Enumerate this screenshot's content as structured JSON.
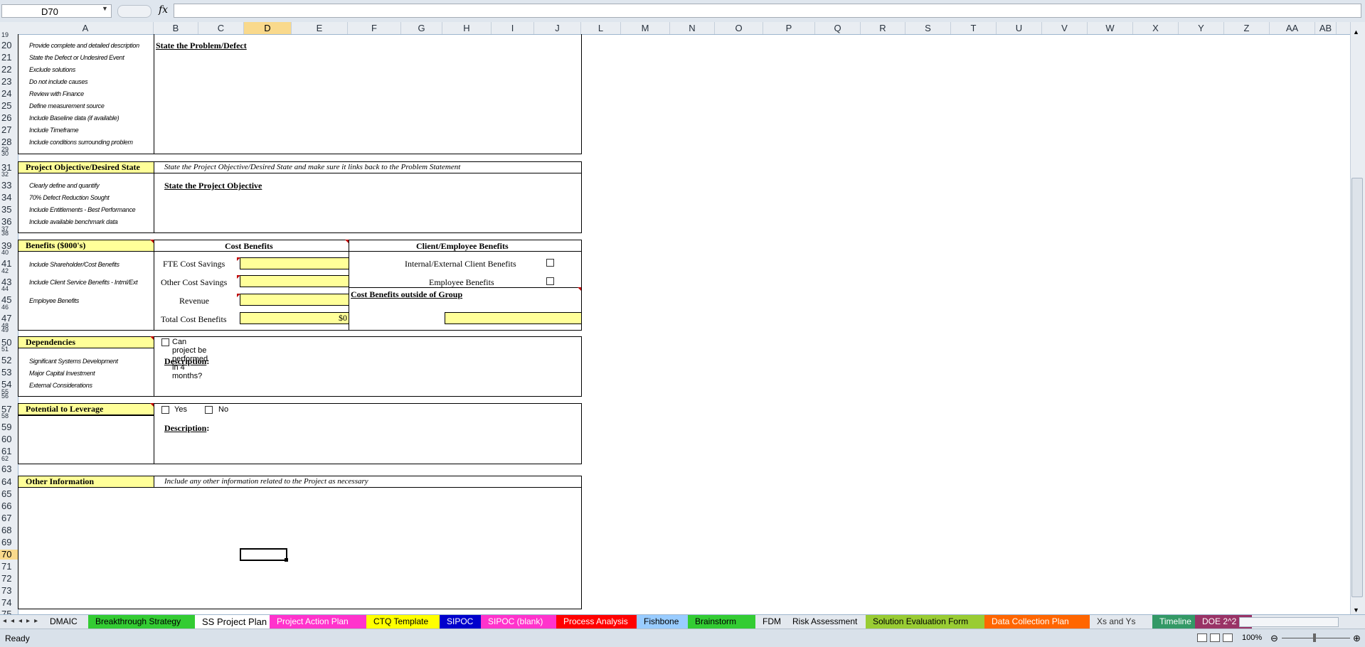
{
  "formula_bar": {
    "name_box": "D70",
    "fx": "fx",
    "formula": ""
  },
  "columns": [
    "A",
    "B",
    "C",
    "D",
    "E",
    "F",
    "G",
    "H",
    "I",
    "J",
    "L",
    "M",
    "N",
    "O",
    "P",
    "Q",
    "R",
    "S",
    "T",
    "U",
    "V",
    "W",
    "X",
    "Y",
    "Z",
    "AA",
    "AB"
  ],
  "selected_column": "D",
  "rows": [
    "19",
    "20",
    "21",
    "22",
    "23",
    "24",
    "25",
    "26",
    "27",
    "28",
    "29",
    "30",
    "31",
    "32",
    "33",
    "34",
    "35",
    "36",
    "37",
    "38",
    "39",
    "40",
    "41",
    "42",
    "43",
    "44",
    "45",
    "46",
    "47",
    "48",
    "49",
    "50",
    "51",
    "52",
    "53",
    "54",
    "55",
    "56",
    "57",
    "58",
    "59",
    "60",
    "61",
    "62",
    "63",
    "64",
    "65",
    "66",
    "67",
    "68",
    "69",
    "70",
    "71",
    "72",
    "73",
    "74",
    "75"
  ],
  "selected_row": "70",
  "problem": {
    "hints": [
      "Provide complete and detailed description",
      "State the Defect or Undesired Event",
      "Exclude solutions",
      "Do not include causes",
      "Review with Finance",
      "Define measurement source",
      "Include Baseline data (if available)",
      "Include Timeframe",
      "Include conditions surrounding problem"
    ],
    "title": "State the Problem/Defect"
  },
  "objective": {
    "section": "Project Objective/Desired State",
    "note": "State the Project Objective/Desired State and make sure it links back to the Problem Statement",
    "hints": [
      "Clearly define and quantify",
      "70% Defect Reduction Sought",
      "Include Entitlements - Best Performance",
      "Include available benchmark data"
    ],
    "title": "State the Project Objective"
  },
  "benefits": {
    "section": "Benefits ($000's)",
    "cost_header": "Cost Benefits",
    "client_header": "Client/Employee Benefits",
    "hints": [
      "Include Shareholder/Cost Benefits",
      "Include Client Service Benefits - Intrnl/Ext",
      "Employee Benefits"
    ],
    "fte": "FTE Cost Savings",
    "other": "Other Cost Savings",
    "revenue": "Revenue",
    "total": "Total Cost Benefits",
    "total_value": "$0",
    "internal": "Internal/External Client Benefits",
    "employee": "Employee Benefits",
    "outside": "Cost Benefits outside of Group"
  },
  "dependencies": {
    "section": "Dependencies",
    "question": "Can project be performed in  4 months?",
    "hints": [
      "Significant Systems Development",
      "Major Capital Investment",
      "External Considerations"
    ],
    "desc": "Description",
    "colon": ":"
  },
  "leverage": {
    "section": "Potential to Leverage",
    "yes": "Yes",
    "no": "No",
    "desc": "Description",
    "colon": ":"
  },
  "other": {
    "section": "Other Information",
    "note": "Include any other information related to the Project as necessary"
  },
  "tabs": [
    {
      "label": "DMAIC",
      "color": "#e3e8ee",
      "text": "#000"
    },
    {
      "label": "Breakthrough Strategy",
      "color": "#33cc33",
      "text": "#000"
    },
    {
      "label": "SS Project Plan",
      "color": "#ffffff",
      "text": "#000"
    },
    {
      "label": "Project Action Plan",
      "color": "#ff33cc",
      "text": "#fff"
    },
    {
      "label": "CTQ Template",
      "color": "#ffff00",
      "text": "#000"
    },
    {
      "label": "SIPOC",
      "color": "#0000cc",
      "text": "#fff"
    },
    {
      "label": "SIPOC (blank)",
      "color": "#ff33cc",
      "text": "#fff"
    },
    {
      "label": "Process Analysis",
      "color": "#ff0000",
      "text": "#fff"
    },
    {
      "label": "Fishbone",
      "color": "#99ccff",
      "text": "#000"
    },
    {
      "label": "Brainstorm",
      "color": "#33cc33",
      "text": "#000"
    },
    {
      "label": "FDM",
      "color": "#e3e8ee",
      "text": "#000"
    },
    {
      "label": "Risk Assessment",
      "color": "#e3e8ee",
      "text": "#000"
    },
    {
      "label": "Solution Evaluation Form",
      "color": "#99cc33",
      "text": "#000"
    },
    {
      "label": "Data Collection Plan",
      "color": "#ff6600",
      "text": "#fff"
    },
    {
      "label": "Xs and Ys",
      "color": "#e3e8ee",
      "text": "#333"
    },
    {
      "label": "Timeline",
      "color": "#339966",
      "text": "#fff"
    },
    {
      "label": "DOE 2^2",
      "color": "#993366",
      "text": "#fff"
    }
  ],
  "status": {
    "ready": "Ready",
    "zoom": "100%"
  }
}
